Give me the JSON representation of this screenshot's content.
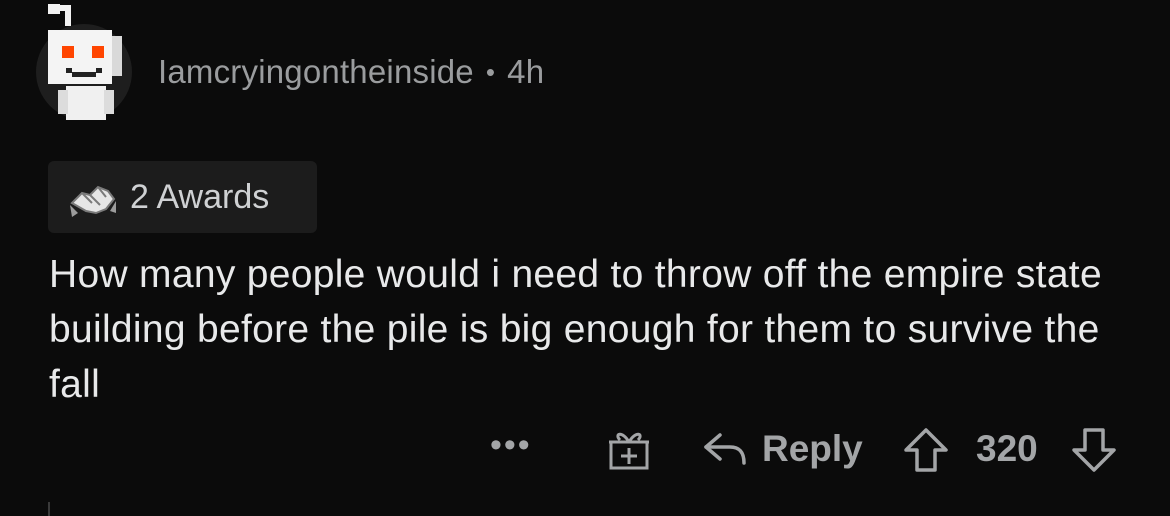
{
  "comment": {
    "username": "Iamcryingontheinside",
    "separator": "•",
    "age": "4h",
    "awards_label": "2 Awards",
    "body": "How many people would i need to throw off the empire state building before the pile is big enough for them to survive the fall",
    "more_label": "•••",
    "reply_label": "Reply",
    "score": "320"
  },
  "icons": {
    "avatar": "reddit-snoo-avatar-icon",
    "award": "handshake-award-icon",
    "gift": "gift-icon",
    "reply": "reply-arrow-icon",
    "upvote": "upvote-arrow-icon",
    "downvote": "downvote-arrow-icon"
  },
  "colors": {
    "background": "#0b0b0b",
    "text": "#e8e9ea",
    "muted": "#a3a5a7",
    "award_bg": "#1c1c1c",
    "avatar_eyes": "#ff4500"
  }
}
